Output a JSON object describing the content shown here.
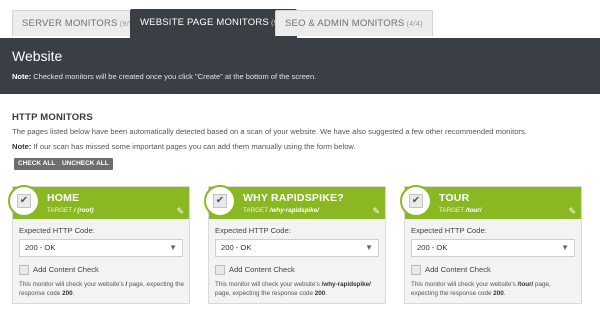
{
  "tabs": [
    {
      "label": "SERVER MONITORS",
      "count": "(9/9)"
    },
    {
      "label": "WEBSITE PAGE MONITORS",
      "count": "(9/9)"
    },
    {
      "label": "SEO & ADMIN MONITORS",
      "count": "(4/4)"
    }
  ],
  "banner": {
    "title": "Website",
    "note_label": "Note:",
    "note_text": "Checked monitors will be created once you click \"Create\" at the bottom of the screen."
  },
  "http": {
    "title": "HTTP MONITORS",
    "description": "The pages listed below have been automatically detected based on a scan of your website. We have also suggested a few other recommended monitors.",
    "note_label": "Note:",
    "note_text": "If our scan has missed some important pages you can add them manually using the form below.",
    "check_all": "CHECK ALL",
    "uncheck_all": "UNCHECK ALL"
  },
  "cards": [
    {
      "name": "HOME",
      "target_label": "TARGET",
      "target": "/ (root)",
      "code_label": "Expected HTTP Code:",
      "code_value": "200 - OK",
      "content_check_label": "Add Content Check",
      "info_a": "This monitor will check your website's ",
      "path": "/",
      "info_b": " page, expecting the response code ",
      "code": "200",
      "info_c": ".",
      "checked": true,
      "content_checked": false
    },
    {
      "name": "WHY RAPIDSPIKE?",
      "target_label": "TARGET",
      "target": "/why-rapidspike/",
      "code_label": "Expected HTTP Code:",
      "code_value": "200 - OK",
      "content_check_label": "Add Content Check",
      "info_a": "This monitor will check your website's ",
      "path": "/why-rapidspike/",
      "info_b": " page, expecting the response code ",
      "code": "200",
      "info_c": ".",
      "checked": true,
      "content_checked": false
    },
    {
      "name": "TOUR",
      "target_label": "TARGET",
      "target": "/tour/",
      "code_label": "Expected HTTP Code:",
      "code_value": "200 - OK",
      "content_check_label": "Add Content Check",
      "info_a": "This monitor will check your website's ",
      "path": "/tour/",
      "info_b": " page, expecting the response code ",
      "code": "200",
      "info_c": ".",
      "checked": true,
      "content_checked": false
    }
  ],
  "colors": {
    "accent": "#8ab823",
    "banner": "#3a3f45"
  },
  "icons": {
    "edit": "edit-icon",
    "dropdown": "chevron-down-icon",
    "check": "checkmark-icon"
  }
}
